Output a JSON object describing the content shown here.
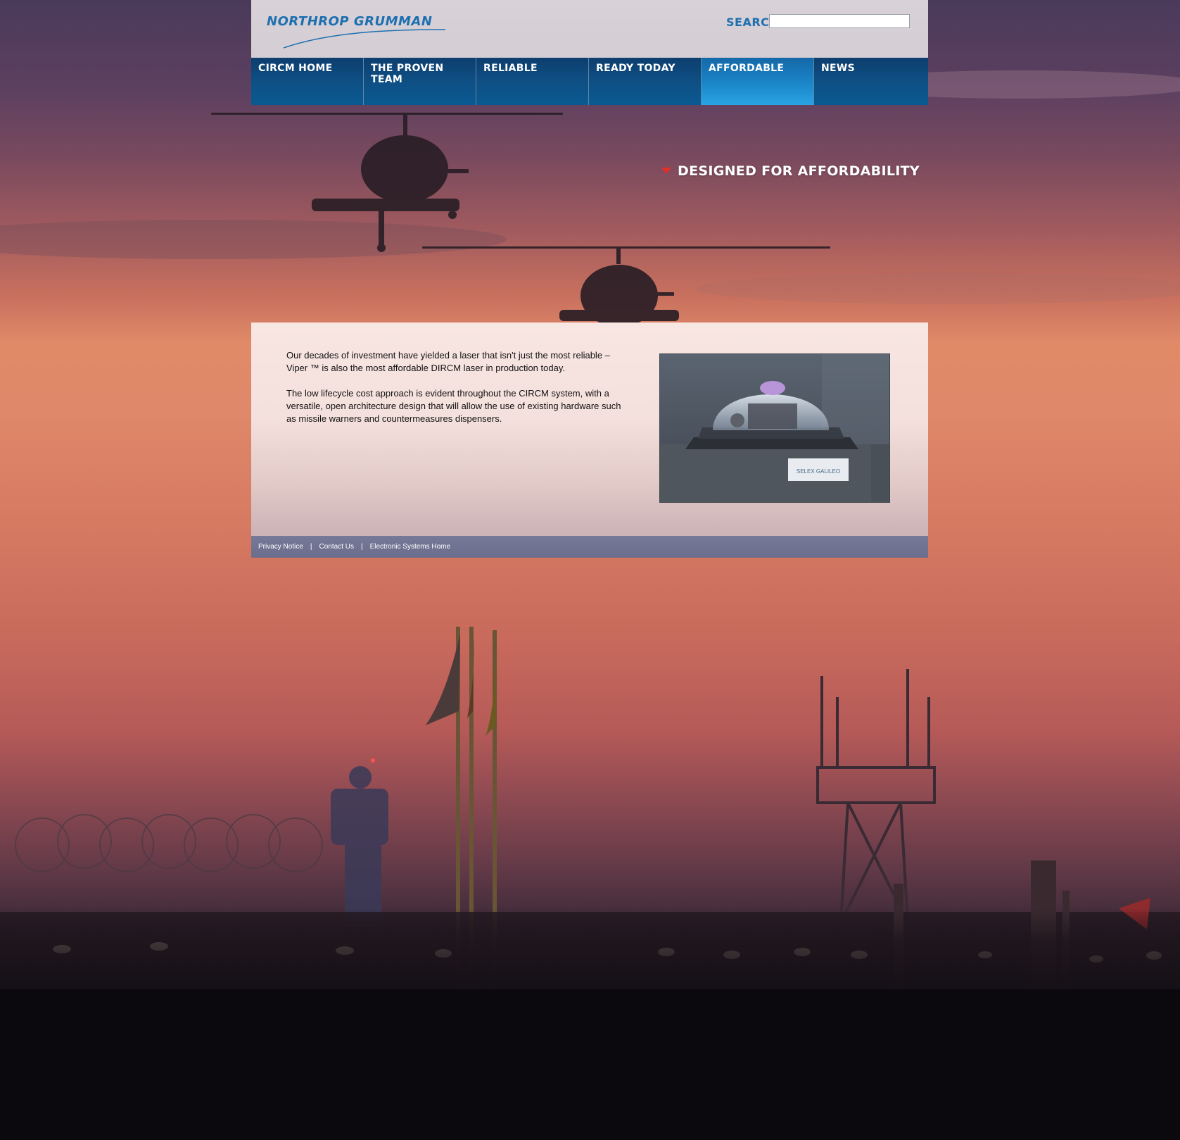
{
  "header": {
    "logo_text": "NORTHROP GRUMMAN",
    "search_label": "SEARCH",
    "search_value": ""
  },
  "nav": {
    "items": [
      {
        "label": "CIRCM HOME",
        "active": false
      },
      {
        "label": "THE PROVEN TEAM",
        "active": false
      },
      {
        "label": "RELIABLE",
        "active": false
      },
      {
        "label": "READY TODAY",
        "active": false
      },
      {
        "label": "AFFORDABLE",
        "active": true
      },
      {
        "label": "NEWS",
        "active": false
      }
    ]
  },
  "section": {
    "heading": "DESIGNED FOR AFFORDABILITY"
  },
  "content": {
    "paragraph_1": "Our decades of investment have yielded a laser that isn't just the most reliable – Viper ™ is also the most affordable DIRCM laser in production today.",
    "paragraph_2": "The low lifecycle cost approach is evident throughout the CIRCM system, with a versatile, open architecture design that will allow the use of existing hardware such as missile warners and countermeasures dispensers.",
    "image_label": "SELEX GALILEO"
  },
  "footer": {
    "links": [
      "Privacy Notice",
      "Contact Us",
      "Electronic Systems Home"
    ],
    "separator": "|"
  },
  "colors": {
    "brand_blue": "#1e6fb0",
    "nav_dark": "#0d3e6e",
    "nav_active": "#1a86c8",
    "accent_red": "#e0302a",
    "footer": "#6a6e8c"
  }
}
